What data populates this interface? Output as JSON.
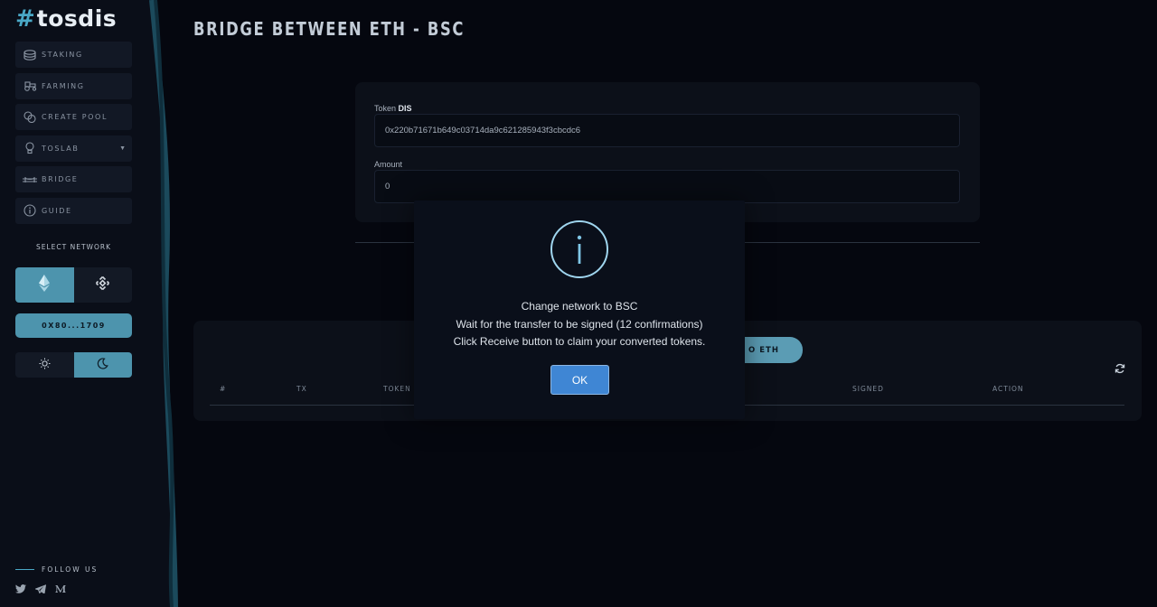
{
  "brand": {
    "hash": "#",
    "name": "tosdis"
  },
  "sidebar": {
    "items": [
      {
        "label": "STAKING",
        "icon": "staking-icon"
      },
      {
        "label": "FARMING",
        "icon": "tractor-icon"
      },
      {
        "label": "CREATE POOL",
        "icon": "coins-icon"
      },
      {
        "label": "TOSLAB",
        "icon": "lightbulb-icon"
      },
      {
        "label": "BRIDGE",
        "icon": "bridge-icon"
      },
      {
        "label": "GUIDE",
        "icon": "info-icon"
      }
    ],
    "select_network_label": "SELECT NETWORK",
    "networks": [
      {
        "name": "ethereum-icon",
        "active": true
      },
      {
        "name": "binance-icon",
        "active": false
      }
    ],
    "wallet_address": "0X80...1709",
    "theme": {
      "active": "dark"
    },
    "follow_label": "FOLLOW US",
    "socials": [
      "twitter-icon",
      "telegram-icon",
      "medium-icon"
    ]
  },
  "page": {
    "title": "BRIDGE BETWEEN ETH - BSC",
    "token_label": "Token",
    "token_symbol": "DIS",
    "token_address": "0x220b71671b649c03714da9c621285943f3cbcdc6",
    "amount_label": "Amount",
    "amount_value": "0"
  },
  "history": {
    "button_label": "O ETH",
    "columns": [
      "#",
      "TX",
      "TOKEN",
      "SIGNED",
      "ACTION"
    ]
  },
  "modal": {
    "icon": "info-icon",
    "line1": "Change network to BSC",
    "line2": "Wait for the transfer to be signed (12 confirmations)",
    "line3": "Click Receive button to claim your converted tokens.",
    "ok_label": "OK"
  },
  "colors": {
    "accent": "#4d94ad",
    "background": "#05070f",
    "ok_button": "#3f86d4"
  }
}
